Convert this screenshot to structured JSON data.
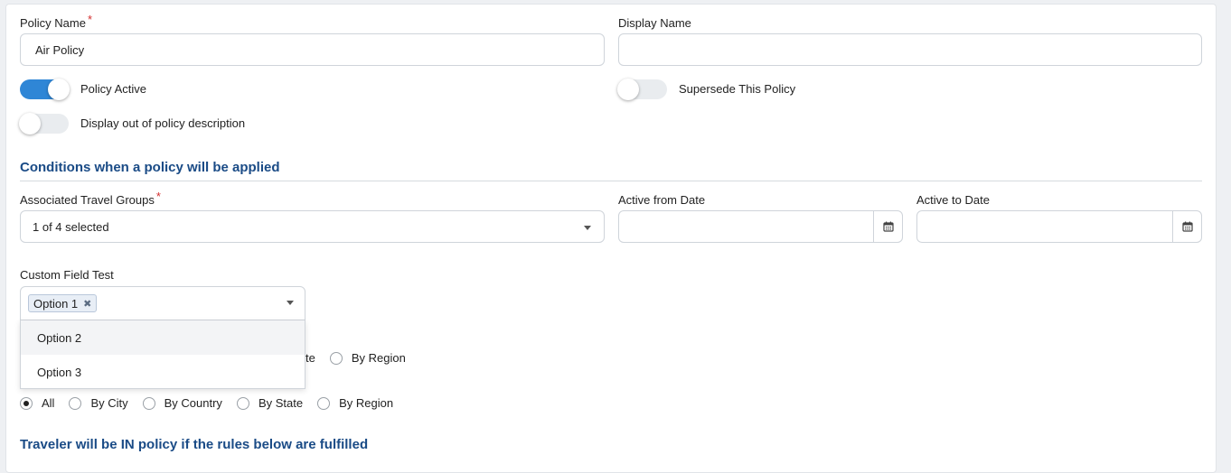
{
  "policy_name": {
    "label": "Policy Name",
    "required": "*",
    "value": "Air Policy"
  },
  "display_name": {
    "label": "Display Name",
    "value": ""
  },
  "toggles": {
    "policy_active": {
      "label": "Policy Active",
      "on": true
    },
    "supersede": {
      "label": "Supersede This Policy",
      "on": false
    },
    "display_out": {
      "label": "Display out of policy description",
      "on": false
    }
  },
  "conditions": {
    "title": "Conditions when a policy will be applied",
    "travel_groups": {
      "label": "Associated Travel Groups",
      "required": "*",
      "value": "1 of 4 selected"
    },
    "active_from": {
      "label": "Active from Date",
      "value": ""
    },
    "active_to": {
      "label": "Active to Date",
      "value": ""
    }
  },
  "custom_field": {
    "label": "Custom Field Test",
    "selected_tag": "Option 1",
    "options": [
      "Option 2",
      "Option 3"
    ]
  },
  "radio_row_1": {
    "partial": "te",
    "last": "By Region"
  },
  "radio_row_2": {
    "options": [
      "All",
      "By City",
      "By Country",
      "By State",
      "By Region"
    ],
    "selected": "All"
  },
  "rules_title": "Traveler will be IN policy if the rules below are fulfilled",
  "colors": {
    "accent": "#2f86d6",
    "section": "#1a4b86",
    "required": "#d32f2f"
  }
}
